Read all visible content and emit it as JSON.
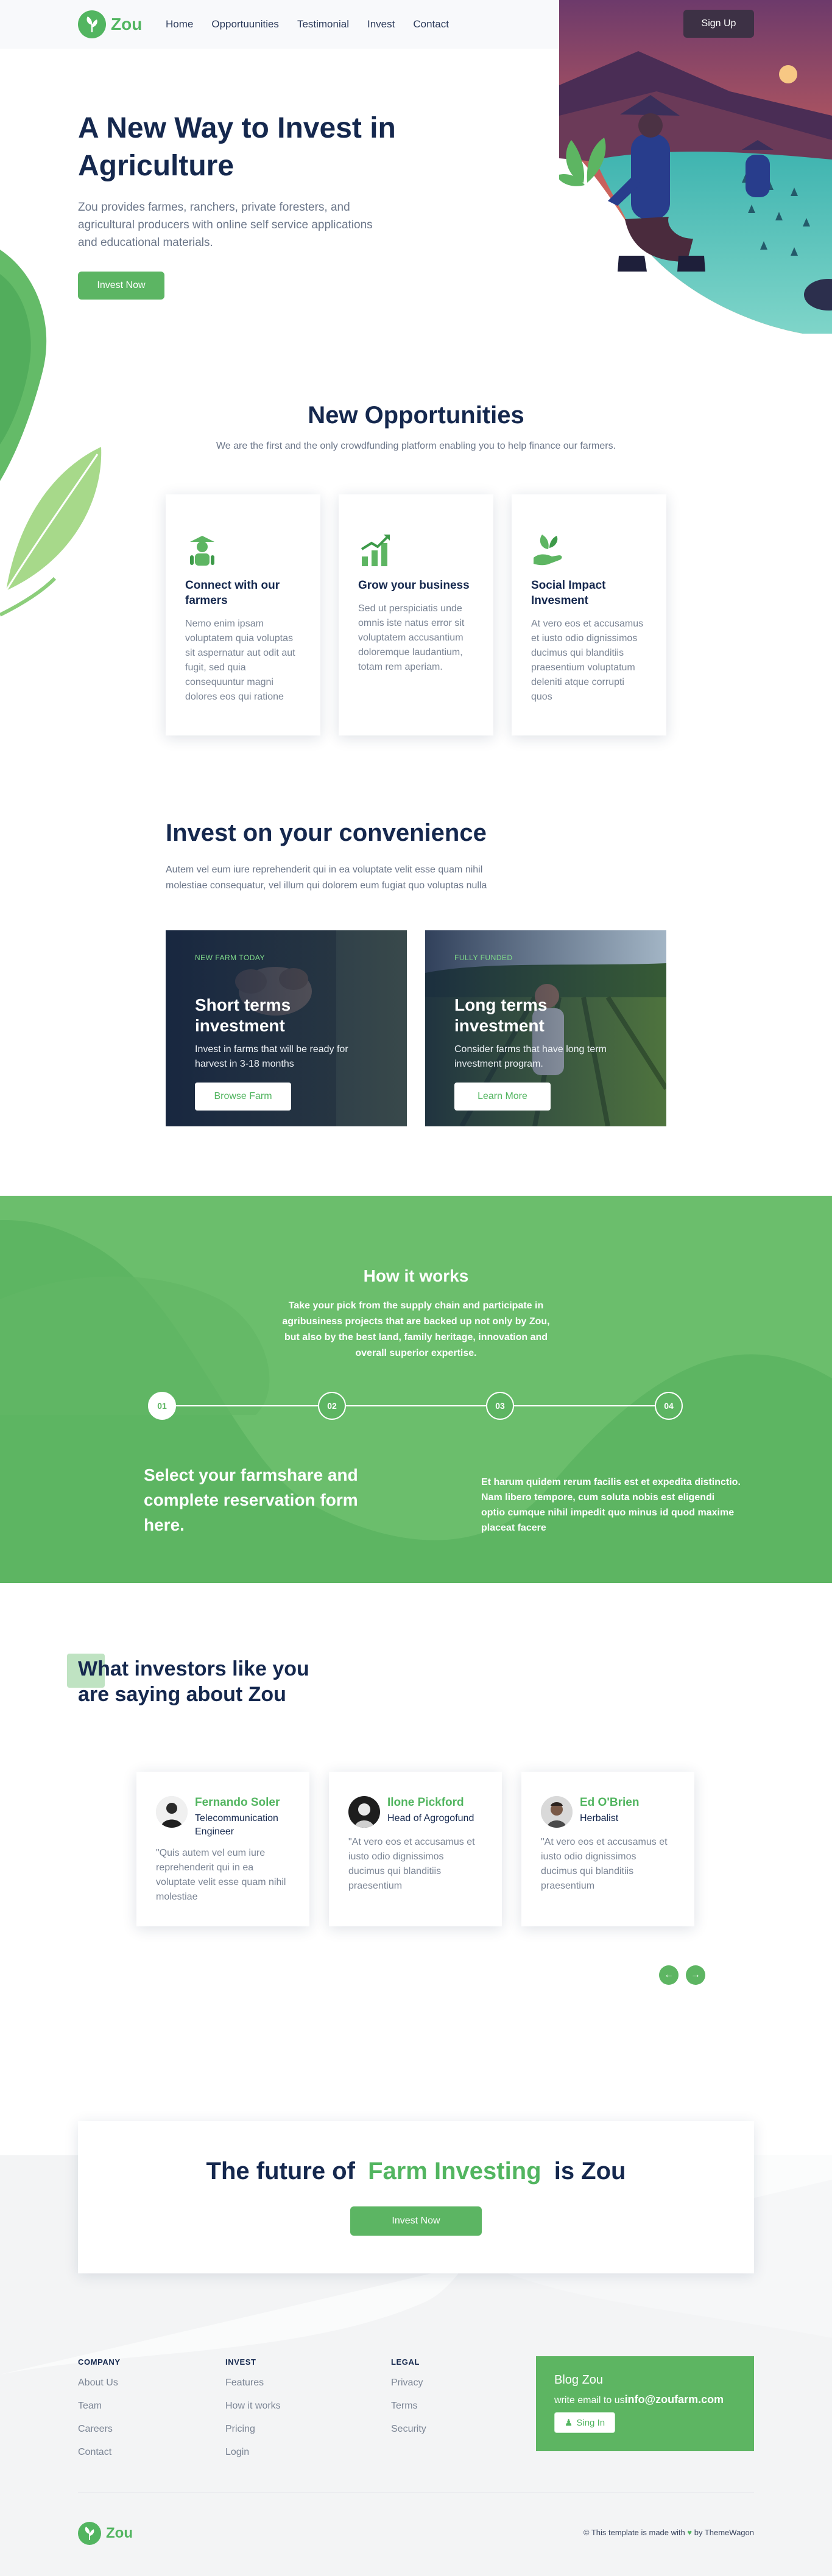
{
  "brand": {
    "name": "Zou",
    "accent": "#5cb563",
    "navy": "#15284e"
  },
  "nav": {
    "links": [
      "Home",
      "Opportuunities",
      "Testimonial",
      "Invest",
      "Contact"
    ],
    "signup_label": "Sign Up"
  },
  "hero": {
    "title": "A New Way to Invest in Agriculture",
    "text": "Zou provides farmes, ranchers, private foresters, and agricultural producers with online self service applications and educational materials.",
    "button_label": "Invest Now"
  },
  "opportunities": {
    "title": "New Opportunities",
    "subtitle": "We are the first and the only crowdfunding platform enabling you to help finance our farmers.",
    "cards": [
      {
        "icon": "farmer-icon",
        "title": "Connect with our farmers",
        "text": "Nemo enim ipsam voluptatem quia voluptas sit aspernatur aut odit aut fugit, sed quia consequuntur magni dolores eos qui ratione"
      },
      {
        "icon": "growth-chart-icon",
        "title": "Grow your business",
        "text": "Sed ut perspiciatis unde omnis iste natus error sit voluptatem accusantium doloremque laudantium, totam rem aperiam."
      },
      {
        "icon": "hand-plant-icon",
        "title": "Social Impact Invesment",
        "text": "At vero eos et accusamus et iusto odio dignissimos ducimus qui blanditiis praesentium voluptatum deleniti atque corrupti quos"
      }
    ]
  },
  "convenience": {
    "title": "Invest on your convenience",
    "subtitle": "Autem vel eum iure reprehenderit qui in ea voluptate velit esse quam nihil molestiae consequatur, vel illum qui dolorem eum fugiat quo voluptas nulla",
    "cards": [
      {
        "tag": "NEW FARM TODAY",
        "title": "Short terms investment",
        "text": "Invest in farms that will be ready for harvest in 3-18 months",
        "button": "Browse Farm"
      },
      {
        "tag": "FULLY FUNDED",
        "title": "Long terms investment",
        "text": "Consider farms that have long term investment program.",
        "button": "Learn More"
      }
    ]
  },
  "how": {
    "title": "How it works",
    "text": "Take your pick from the supply chain and participate in agribusiness projects that are backed up not only by Zou, but also by the best land, family heritage, innovation and overall superior expertise.",
    "steps": [
      "01",
      "02",
      "03",
      "04"
    ],
    "heading": "Select your farmshare and complete reservation form here.",
    "detail": "Et harum quidem rerum facilis est et expedita distinctio. Nam libero tempore, cum soluta nobis est eligendi optio cumque nihil impedit quo minus id quod maxime placeat facere"
  },
  "testimonials": {
    "title": "What investors like you are saying about Zou",
    "items": [
      {
        "name": "Fernando Soler",
        "role": "Telecommunication Engineer",
        "quote": "\"Quis autem vel eum iure reprehenderit qui in ea voluptate velit esse quam nihil molestiae"
      },
      {
        "name": "Ilone Pickford",
        "role": "Head of Agrogofund",
        "quote": "\"At vero eos et accusamus et iusto odio dignissimos ducimus qui blanditiis praesentium"
      },
      {
        "name": "Ed O'Brien",
        "role": "Herbalist",
        "quote": "\"At vero eos et accusamus et iusto odio dignissimos ducimus qui blanditiis praesentium"
      }
    ]
  },
  "cta": {
    "pre": "The future of",
    "highlight": "Farm Investing",
    "post": "is Zou",
    "button": "Invest Now"
  },
  "footer": {
    "columns": [
      {
        "title": "COMPANY",
        "links": [
          "About Us",
          "Team",
          "Careers",
          "Contact"
        ]
      },
      {
        "title": "INVEST",
        "links": [
          "Features",
          "How it works",
          "Pricing",
          "Login"
        ]
      },
      {
        "title": "LEGAL",
        "links": [
          "Privacy",
          "Terms",
          "Security"
        ]
      }
    ],
    "blog": {
      "title": "Blog Zou",
      "email_prefix": "write email to us",
      "email": "info@zoufarm.com",
      "signin": "Sing In"
    },
    "credit_pre": "© This template is made with",
    "credit_post": "by ThemeWagon"
  }
}
